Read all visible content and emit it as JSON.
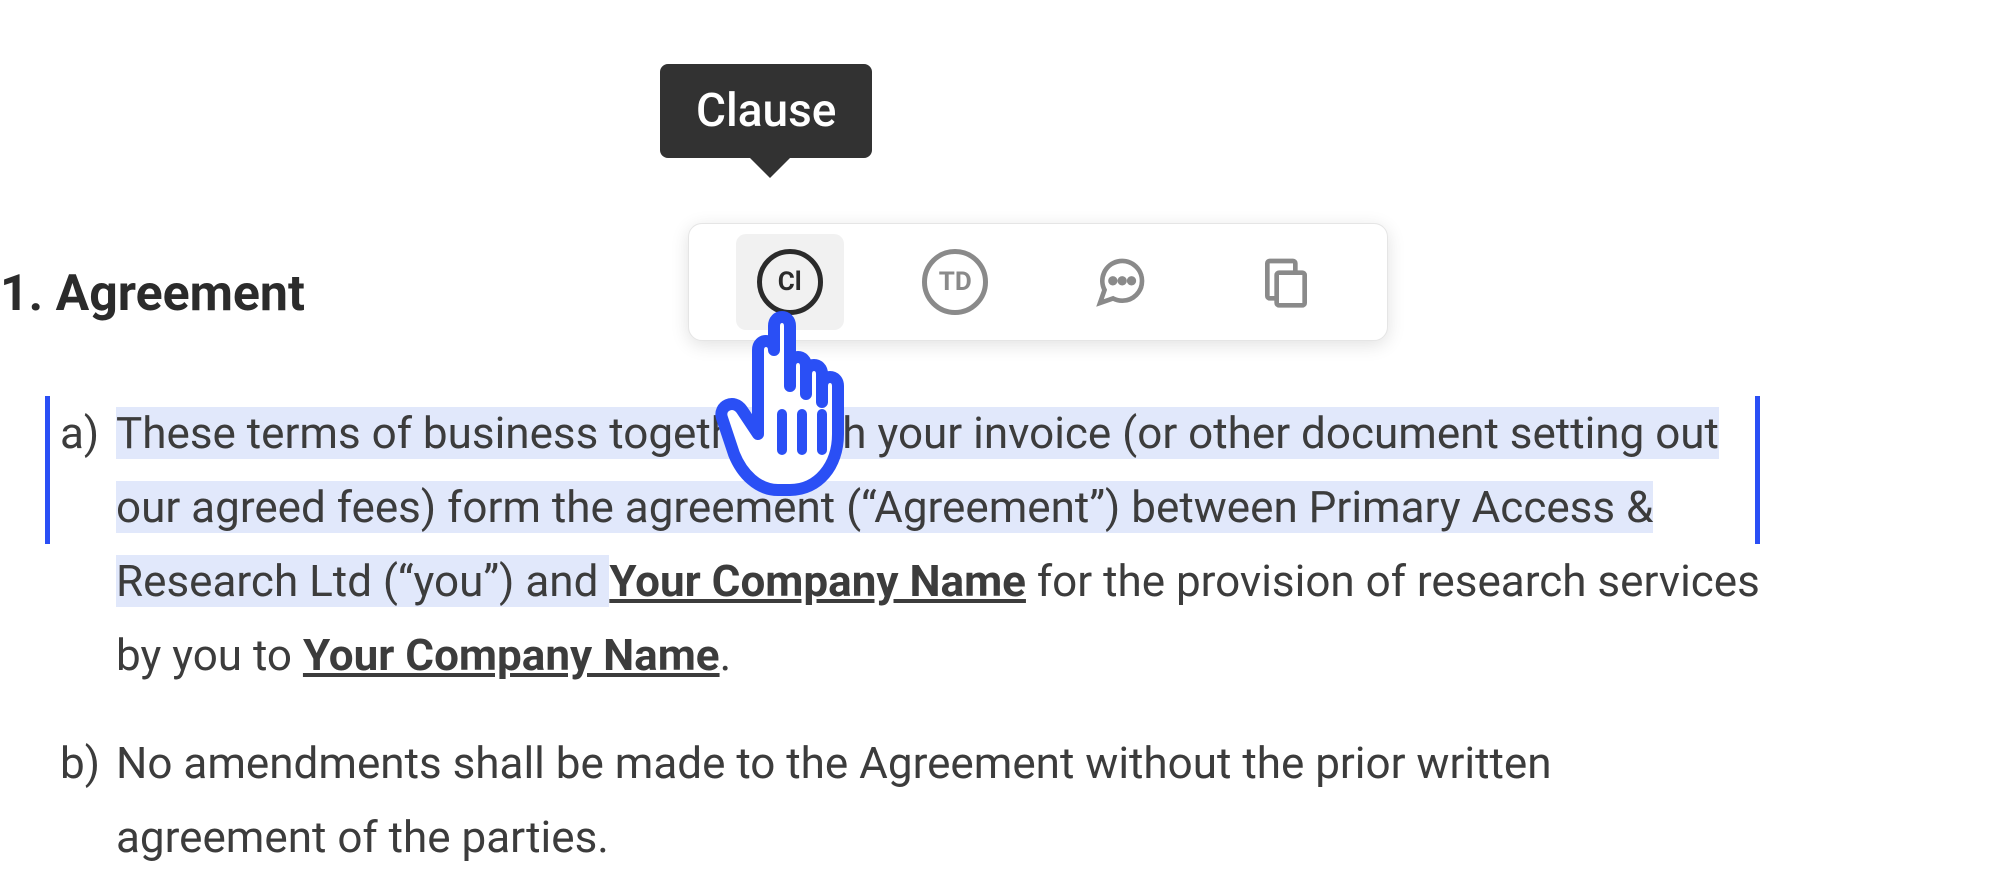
{
  "heading": "1. Agreement",
  "clause_a": {
    "label": "a)",
    "highlighted": "These terms of business together with your invoice (or other document setting out our agreed fees) form the agreement (“Agreement”) between Primary Access & Research Ltd (“you”) and ",
    "placeholder1": "Your Company Name",
    "mid": " for the provision of research services by you to ",
    "placeholder2": "Your Company Name",
    "tail": "."
  },
  "clause_b": {
    "label": "b)",
    "text": "No amendments shall be made to the Agreement without the prior written agreement of the parties."
  },
  "tooltip": "Clause",
  "toolbar": {
    "clause": {
      "glyph": "Cl",
      "name": "clause-icon"
    },
    "term": {
      "glyph": "TD",
      "name": "term-definition-icon"
    },
    "comment": {
      "name": "comment-icon"
    },
    "copy": {
      "name": "copy-icon"
    }
  }
}
